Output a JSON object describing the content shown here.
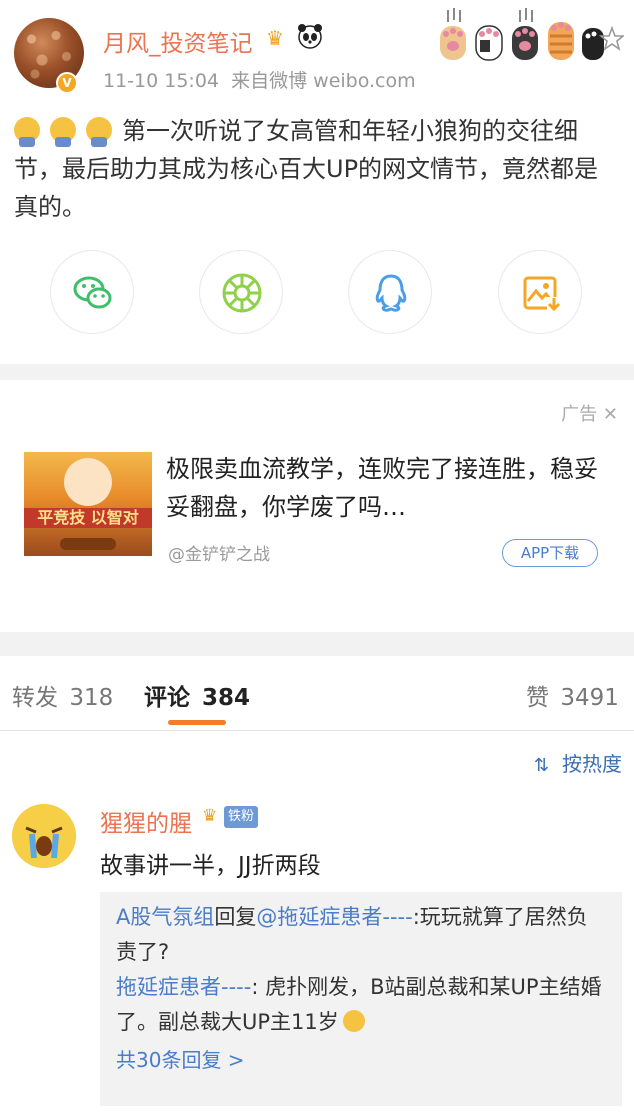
{
  "post": {
    "username": "月风_投资笔记",
    "time": "11-10 15:04",
    "source": "来自微博 weibo.com",
    "text": "第一次听说了女高管和年轻小狼狗的交往细节，最后助力其成为核心百大UP的网文情节，竟然都是真的。",
    "verified_badge": "V",
    "icons": [
      "crown-icon",
      "panda-icon",
      "paw-icons",
      "star-icon"
    ]
  },
  "share": [
    "wechat-icon",
    "moments-icon",
    "qq-icon",
    "save-image-icon"
  ],
  "ad": {
    "tag": "广告",
    "close": "✕",
    "image_text": "平竞技 以智对",
    "title": "极限卖血流教学，连败完了接连胜，稳妥妥翻盘，你学废了吗…",
    "author": "@金铲铲之战",
    "button": "APP下载"
  },
  "tabs": {
    "repost_label": "转发",
    "repost_count": "318",
    "comment_label": "评论",
    "comment_count": "384",
    "like_label": "赞",
    "like_count": "3491"
  },
  "sort": {
    "label": "按热度",
    "icon": "sort-icon"
  },
  "comment": {
    "name": "猩猩的腥",
    "fan_badge": "铁粉",
    "text": "故事讲一半，JJ折两段",
    "replies": [
      {
        "name": "A股气氛组",
        "reply_word": "回复",
        "mention": "@拖延症患者----",
        "text": ":玩玩就算了居然负责了?"
      },
      {
        "name": "拖延症患者----",
        "text": ": 虎扑刚发，B站副总裁和某UP主结婚了。副总裁大UP主11岁"
      }
    ],
    "more": "共30条回复 >"
  },
  "colors": {
    "accent": "#eb7350",
    "link": "#4a7cc7",
    "tab_underline": "#f57d28",
    "muted": "#999999",
    "gap": "#f2f2f2"
  }
}
